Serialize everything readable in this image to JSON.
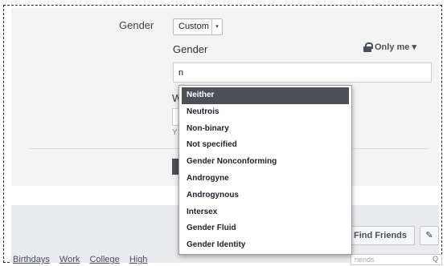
{
  "form": {
    "gender_label": "Gender",
    "select_value": "Custom",
    "select_caret": "▾",
    "custom_gender_label": "Gender",
    "privacy_label": "Only me ▾",
    "input_value": "n",
    "fragment_w": "W",
    "fragment_y": "Y"
  },
  "dropdown": {
    "options": [
      "Neither",
      "Neutrois",
      "Non-binary",
      "Not specified",
      "Gender Nonconforming",
      "Androgyne",
      "Androgynous",
      "Intersex",
      "Gender Fluid",
      "Gender Identity"
    ],
    "highlighted_index": 0
  },
  "footer": {
    "find_friends_label": "Find Friends",
    "pencil_glyph": "✎",
    "search_placeholder": "riends",
    "search_glyph": "Q",
    "tabs": [
      "Birthdays",
      "Work",
      "College",
      "High"
    ]
  },
  "colors": {
    "highlight": "#4b4f56",
    "panel": "#f3f3f3",
    "footer_band": "#e9ebee"
  }
}
